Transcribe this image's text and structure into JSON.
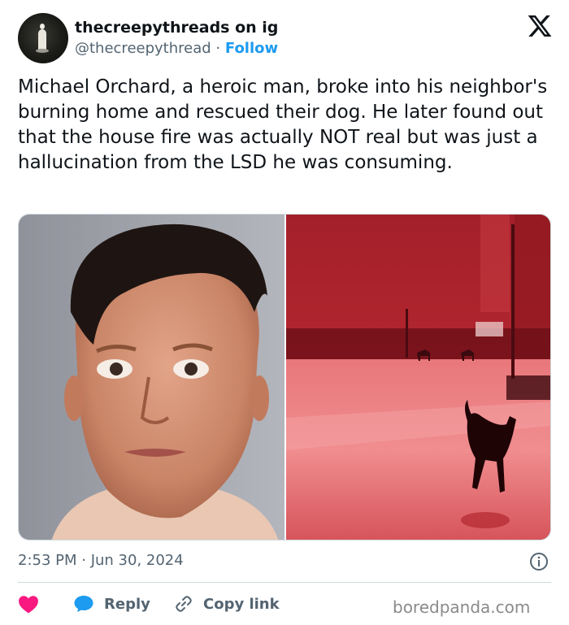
{
  "author": {
    "name": "thecreepythreads on ig",
    "handle": "@thecreepythread",
    "separator": "·",
    "follow_label": "Follow",
    "avatar_icon": "ghost-figure-avatar"
  },
  "platform_icon": "x-logo-icon",
  "tweet": {
    "text": "Michael Orchard, a heroic man, broke into his neighbor's burning home and rescued their dog. He later found out that the house fire was actually NOT real but was just a hallucination from the LSD he was consuming."
  },
  "media": {
    "left_image": "mugshot-photo",
    "right_image": "red-lit-street-dog-photo"
  },
  "timestamp": "2:53 PM · Jun 30, 2024",
  "actions": {
    "reply_label": "Reply",
    "copy_label": "Copy link"
  },
  "watermark": "boredpanda.com",
  "colors": {
    "accent": "#1d9bf0",
    "like": "#f91880",
    "text": "#0f1419",
    "muted": "#536471"
  }
}
